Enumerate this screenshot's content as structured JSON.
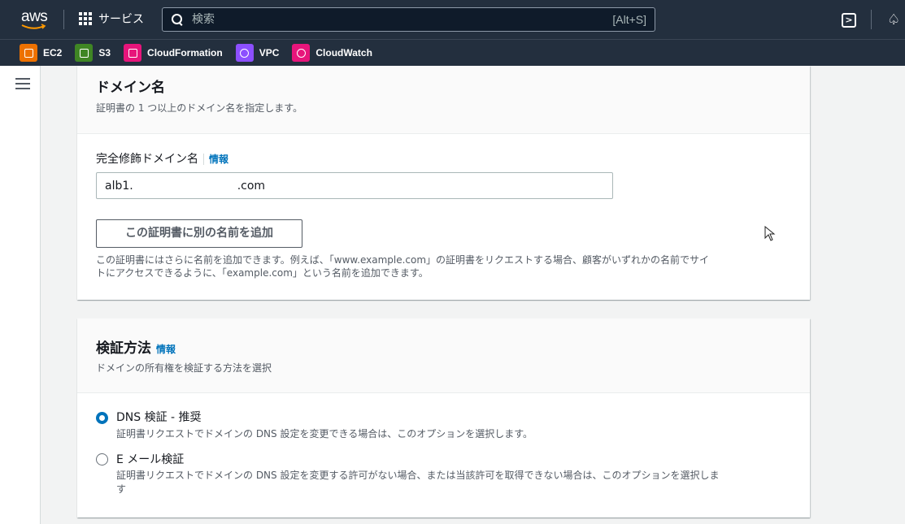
{
  "topnav": {
    "logo_text": "aws",
    "services_label": "サービス",
    "search_placeholder": "検索",
    "search_shortcut": "[Alt+S]"
  },
  "favorites": [
    {
      "label": "EC2",
      "color": "#ed7100"
    },
    {
      "label": "S3",
      "color": "#3f8624"
    },
    {
      "label": "CloudFormation",
      "color": "#e7157b"
    },
    {
      "label": "VPC",
      "color": "#8c4fff"
    },
    {
      "label": "CloudWatch",
      "color": "#e7157b"
    }
  ],
  "domain_card": {
    "title": "ドメイン名",
    "description": "証明書の 1 つ以上のドメイン名を指定します。",
    "field_label": "完全修飾ドメイン名",
    "info_label": "情報",
    "field_value_prefix": "alb1.",
    "field_value_suffix": ".com",
    "add_name_button": "この証明書に別の名前を追加",
    "help_line1": "この証明書にはさらに名前を追加できます。例えば、「www.example.com」の証明書をリクエストする場合、顧客がいずれかの名前でサイ",
    "help_line2": "トにアクセスできるように、「example.com」という名前を追加できます。"
  },
  "validation_card": {
    "title": "検証方法",
    "info_label": "情報",
    "description": "ドメインの所有権を検証する方法を選択",
    "options": [
      {
        "label": "DNS 検証 - 推奨",
        "description": "証明書リクエストでドメインの DNS 設定を変更できる場合は、このオプションを選択します。",
        "selected": true
      },
      {
        "label": "E メール検証",
        "description_line1": "証明書リクエストでドメインの DNS 設定を変更する許可がない場合、または当該許可を取得できない場合は、このオプションを選択しま",
        "description_line2": "す",
        "selected": false
      }
    ]
  },
  "colors": {
    "nav_bg": "#232f3e",
    "link": "#0073bb",
    "radio_selected": "#0073bb"
  }
}
